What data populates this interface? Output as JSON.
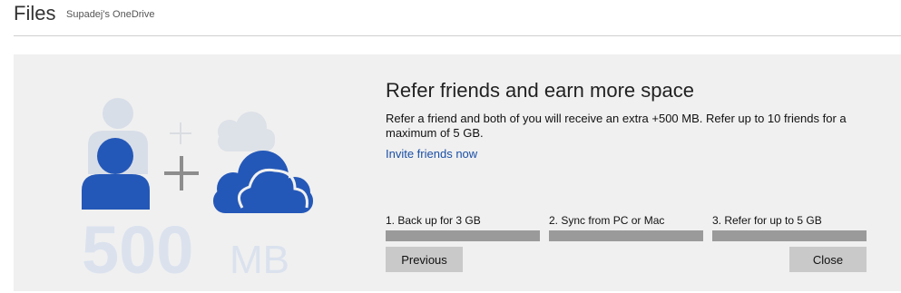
{
  "header": {
    "title": "Files",
    "subtitle": "Supadej's OneDrive"
  },
  "promo": {
    "title": "Refer friends and earn more space",
    "description": "Refer a friend and both of you will receive an extra +500 MB. Refer up to 10 friends for a maximum of 5 GB.",
    "link": "Invite friends now",
    "illustration": {
      "number": "500",
      "unit": "MB",
      "icons": [
        "person-icon",
        "plus-icon",
        "cloud-icon"
      ]
    }
  },
  "steps": [
    {
      "label": "1. Back up for 3 GB"
    },
    {
      "label": "2. Sync from PC or Mac"
    },
    {
      "label": "3. Refer for up to 5 GB"
    }
  ],
  "buttons": {
    "previous": "Previous",
    "close": "Close"
  },
  "colors": {
    "accent_blue": "#1b4fa5",
    "icon_blue": "#2458b8",
    "panel_bg": "#f0f0f0",
    "step_bar": "#9a9a9a",
    "button_bg": "#c9c9c9"
  }
}
